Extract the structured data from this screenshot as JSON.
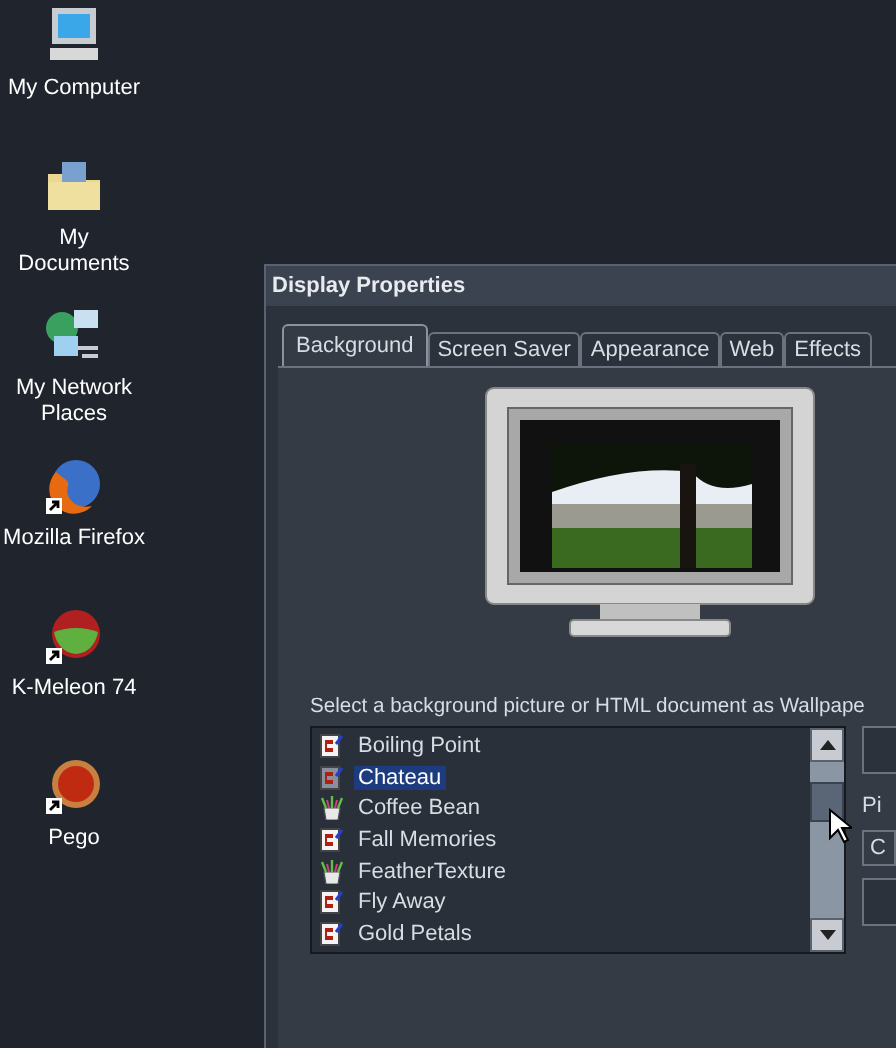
{
  "desktop_icons": [
    {
      "label": "My Computer",
      "kind": "computer"
    },
    {
      "label": "My Documents",
      "kind": "documents"
    },
    {
      "label": "My Network Places",
      "kind": "network"
    },
    {
      "label": "Mozilla Firefox",
      "kind": "firefox"
    },
    {
      "label": "K-Meleon 74",
      "kind": "kmeleon"
    },
    {
      "label": "Pego",
      "kind": "pego"
    }
  ],
  "window": {
    "title": "Display Properties"
  },
  "tabs": [
    {
      "label": "Background",
      "selected": true
    },
    {
      "label": "Screen Saver",
      "selected": false
    },
    {
      "label": "Appearance",
      "selected": false
    },
    {
      "label": "Web",
      "selected": false
    },
    {
      "label": "Effects",
      "selected": false
    }
  ],
  "background_list": {
    "label": "Select a background picture or HTML document as Wallpape",
    "items": [
      {
        "name": "Boiling Point",
        "kind": "html",
        "selected": false
      },
      {
        "name": "Chateau",
        "kind": "html",
        "selected": true
      },
      {
        "name": "Coffee Bean",
        "kind": "image",
        "selected": false
      },
      {
        "name": "Fall Memories",
        "kind": "html",
        "selected": false
      },
      {
        "name": "FeatherTexture",
        "kind": "image",
        "selected": false
      },
      {
        "name": "Fly Away",
        "kind": "html",
        "selected": false
      },
      {
        "name": "Gold Petals",
        "kind": "html",
        "selected": false
      }
    ]
  },
  "position": {
    "label": "Pi",
    "value": "C"
  }
}
